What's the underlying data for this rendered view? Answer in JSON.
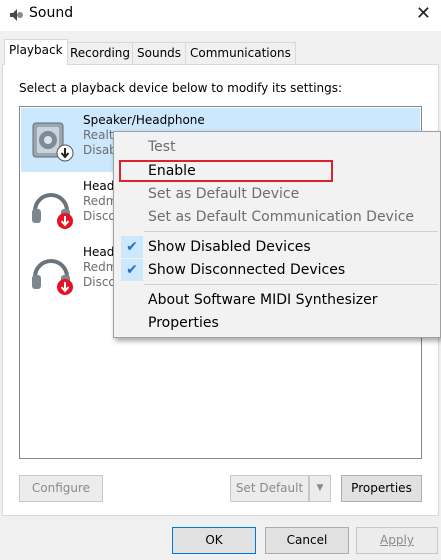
{
  "window": {
    "title": "Sound"
  },
  "tabs": [
    {
      "label": "Playback"
    },
    {
      "label": "Recording"
    },
    {
      "label": "Sounds"
    },
    {
      "label": "Communications"
    }
  ],
  "instructions": "Select a playback device below to modify its settings:",
  "devices": [
    {
      "name": "Speaker/Headphone",
      "line2": "Realt",
      "line3": "Disab",
      "icon": "speaker-icon",
      "status": "disabled"
    },
    {
      "name": "Head",
      "line2": "Redm",
      "line3": "Disco",
      "icon": "headphones-icon",
      "status": "disconnected"
    },
    {
      "name": "Head",
      "line2": "Redm",
      "line3": "Disco",
      "icon": "headphones-icon",
      "status": "disconnected"
    }
  ],
  "context_menu": {
    "items": [
      {
        "label": "Test",
        "disabled": true
      },
      {
        "label": "Enable",
        "highlighted": true
      },
      {
        "label": "Set as Default Device",
        "disabled": true
      },
      {
        "label": "Set as Default Communication Device",
        "disabled": true
      },
      {
        "label": "Show Disabled Devices",
        "checked": true
      },
      {
        "label": "Show Disconnected Devices",
        "checked": true
      },
      {
        "label": "About Software MIDI Synthesizer"
      },
      {
        "label": "Properties"
      }
    ]
  },
  "buttons": {
    "configure": "Configure",
    "set_default": "Set Default",
    "properties": "Properties",
    "ok": "OK",
    "cancel": "Cancel",
    "apply": "Apply"
  },
  "colors": {
    "selection": "#cce8ff",
    "menu_highlight": "#91c9f7",
    "annotation_box": "#d9242f",
    "status_badge": "#e81123"
  }
}
